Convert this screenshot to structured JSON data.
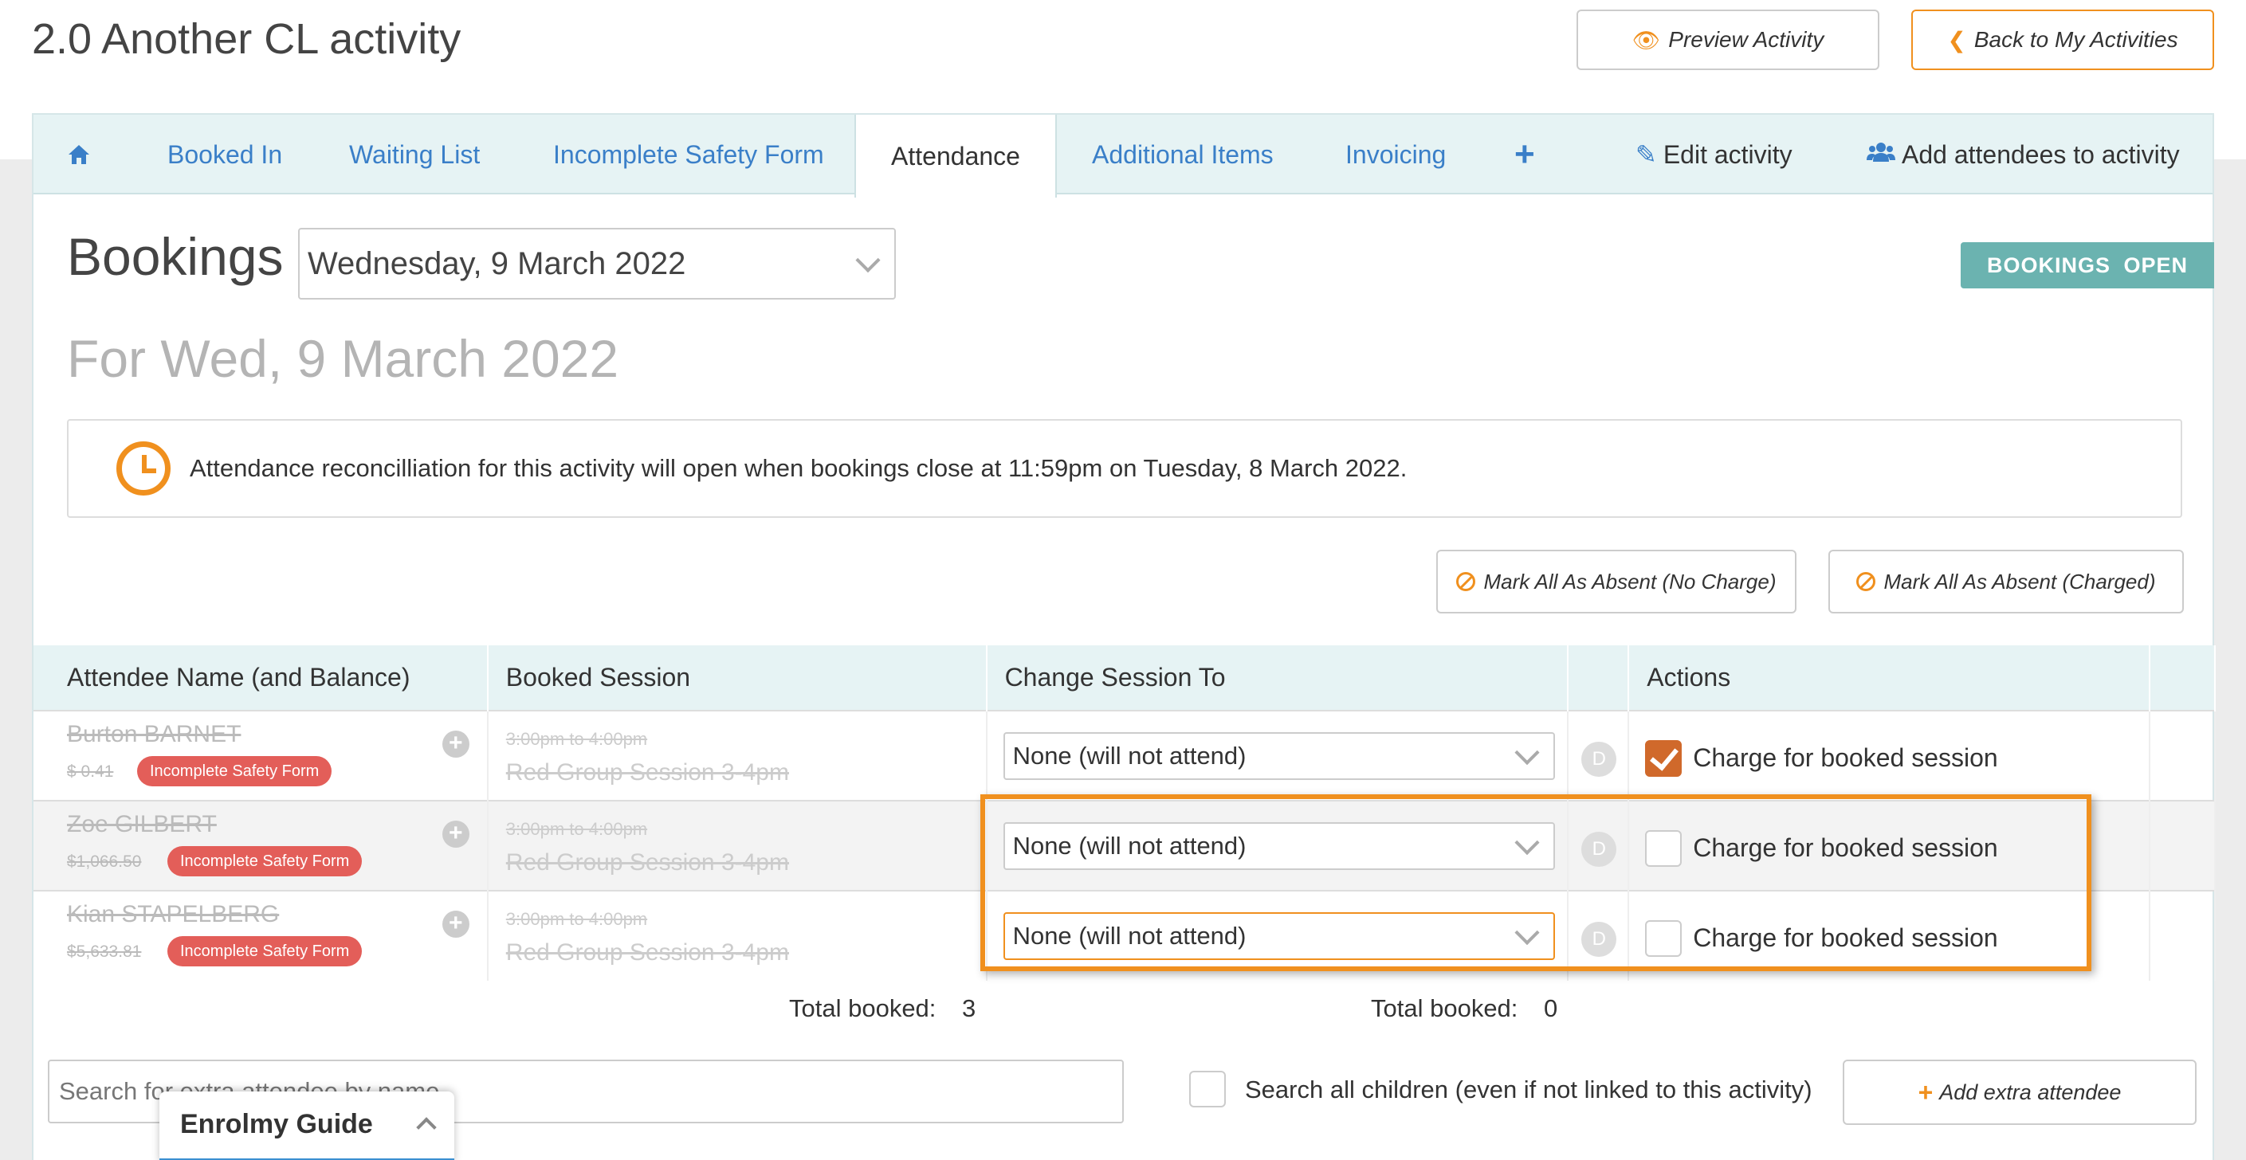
{
  "header": {
    "title": "2.0 Another CL activity",
    "preview_label": "Preview Activity",
    "back_label": "Back to My Activities"
  },
  "tabs": {
    "booked_in": "Booked In",
    "waiting_list": "Waiting List",
    "incomplete_safety": "Incomplete Safety Form",
    "attendance": "Attendance",
    "additional_items": "Additional Items",
    "invoicing": "Invoicing",
    "plus": "+",
    "edit_activity": "Edit activity",
    "add_attendees": "Add attendees to activity"
  },
  "bookings": {
    "title": "Bookings",
    "selected_date": "Wednesday, 9 March 2022",
    "status": "BOOKINGS OPEN",
    "for_date": "For Wed, 9 March 2022"
  },
  "notice": {
    "text": "Attendance reconcilliation for this activity will open when bookings close at 11:59pm on Tuesday, 8 March 2022."
  },
  "mark_buttons": {
    "no_charge": "Mark All As Absent (No Charge)",
    "charged": "Mark All As Absent (Charged)"
  },
  "table": {
    "headers": {
      "name": "Attendee Name (and Balance)",
      "session": "Booked Session",
      "change": "Change Session To",
      "actions": "Actions"
    },
    "rows": [
      {
        "name": "Burton BARNET",
        "balance": "$ 0.41",
        "badge": "Incomplete Safety Form",
        "time": "3:00pm to 4:00pm",
        "session": "Red Group Session 3-4pm",
        "change_to": "None (will not attend)",
        "d": "D",
        "charge_label": "Charge for booked session",
        "charge_checked": true
      },
      {
        "name": "Zoe GILBERT",
        "balance": "$1,066.50",
        "badge": "Incomplete Safety Form",
        "time": "3:00pm to 4:00pm",
        "session": "Red Group Session 3-4pm",
        "change_to": "None (will not attend)",
        "d": "D",
        "charge_label": "Charge for booked session",
        "charge_checked": false
      },
      {
        "name": "Kian STAPELBERG",
        "balance": "$5,633.81",
        "badge": "Incomplete Safety Form",
        "time": "3:00pm to 4:00pm",
        "session": "Red Group Session 3-4pm",
        "change_to": "None (will not attend)",
        "d": "D",
        "charge_label": "Charge for booked session",
        "charge_checked": false
      }
    ]
  },
  "totals": {
    "label": "Total booked:",
    "booked_count": "3",
    "change_count": "0"
  },
  "extra": {
    "search_placeholder": "Search for extra attendee by name",
    "search_all_label": "Search all children (even if not linked to this activity)",
    "add_label": "Add extra attendee"
  },
  "guide": {
    "label": "Enrolmy Guide"
  },
  "colors": {
    "accent_orange": "#f0901e",
    "link_blue": "#3a7fc8",
    "status_teal": "#6bb3b0",
    "badge_red": "#e35e59"
  }
}
